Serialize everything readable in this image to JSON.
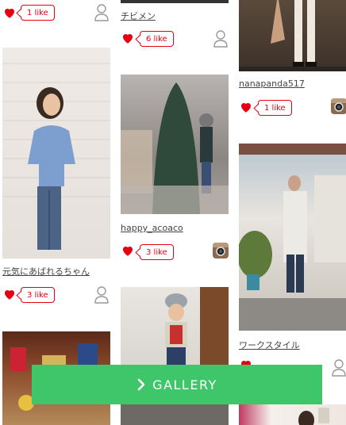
{
  "col1": {
    "top_like": "1 like",
    "caption": "元気にあばれるちゃん",
    "like": "3 like"
  },
  "col2": {
    "top_caption": "チビメン",
    "top_like": "6 like",
    "caption": "happy_acoaco",
    "like": "3 like"
  },
  "col3": {
    "top_caption": "nanapanda517",
    "top_like": "1 like",
    "caption": "ワークスタイル"
  },
  "gallery_button": {
    "label": "GALLERY",
    "icon": "chevron-right-icon",
    "color": "#3fc66a"
  },
  "accent_color": "#e60012"
}
